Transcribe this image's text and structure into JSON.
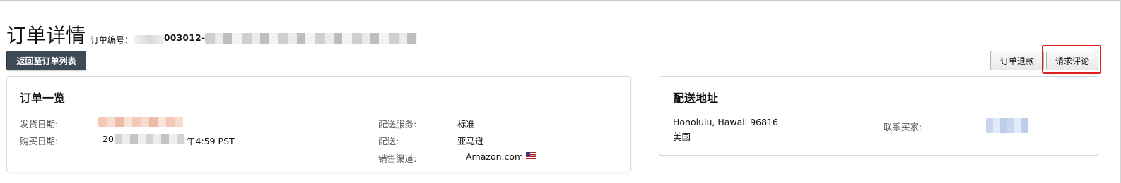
{
  "header": {
    "title": "订单详情",
    "order_id_label": "订单编号：",
    "order_id_partial": "003012-21"
  },
  "actions": {
    "back_label": "返回至订单列表",
    "refund_label": "订单退款",
    "review_label": "请求评论"
  },
  "order_summary": {
    "title": "订单一览",
    "ship_date_label": "发货日期:",
    "purchase_date_label": "购买日期:",
    "purchase_date_partial_prefix": "20",
    "purchase_date_partial_suffix": "午4:59 PST",
    "shipping_service_label": "配送服务:",
    "shipping_service_value": "标准",
    "fulfillment_label": "配送:",
    "fulfillment_value": "亚马逊",
    "sales_channel_label": "销售渠道:",
    "sales_channel_value": "Amazon.com"
  },
  "shipping_address": {
    "title": "配送地址",
    "line1": "Honolulu, Hawaii 96816",
    "line2": "美国",
    "contact_buyer_label": "联系买家:"
  },
  "colors": {
    "back_button_bg": "#3f4a57",
    "highlight": "#e02020"
  }
}
